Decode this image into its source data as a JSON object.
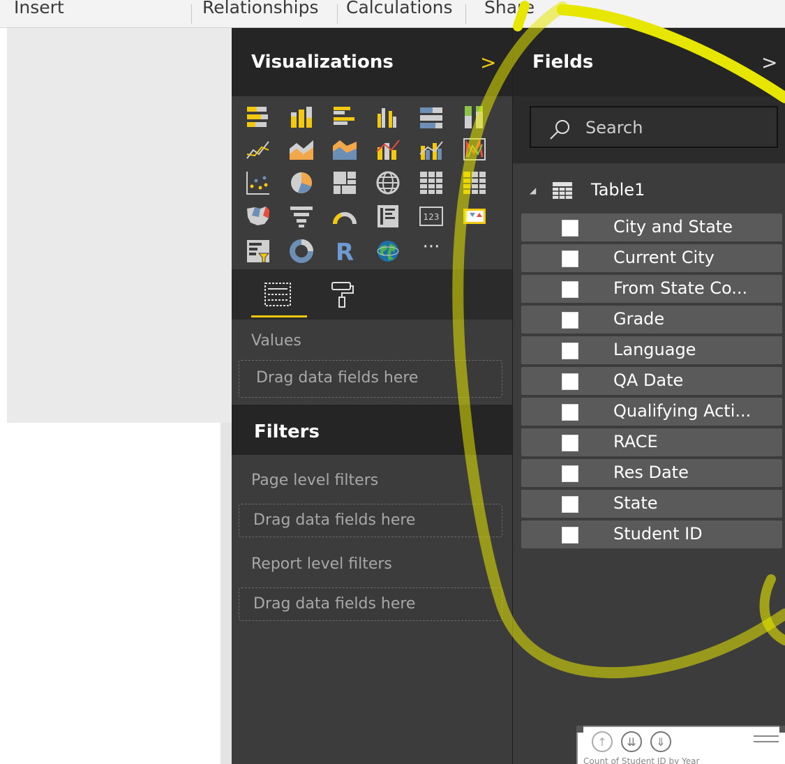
{
  "ribbon": {
    "tabs": [
      "Insert",
      "Relationships",
      "Calculations",
      "Share"
    ]
  },
  "visualizations": {
    "title": "Visualizations",
    "chevron": ">",
    "icons": [
      "stacked-bar-chart-icon",
      "stacked-column-chart-icon",
      "clustered-bar-chart-icon",
      "clustered-column-chart-icon",
      "100-stacked-bar-chart-icon",
      "100-stacked-column-chart-icon",
      "line-chart-icon",
      "area-chart-icon",
      "stacked-area-chart-icon",
      "line-and-stacked-column-icon",
      "line-and-clustered-column-icon",
      "ribbon-chart-icon",
      "scatter-chart-icon",
      "pie-chart-icon",
      "treemap-icon",
      "map-icon",
      "table-icon",
      "matrix-icon",
      "filled-map-icon",
      "funnel-icon",
      "gauge-icon",
      "multi-row-card-icon",
      "card-icon",
      "kpi-icon",
      "slicer-icon",
      "donut-chart-icon",
      "r-script-visual-icon",
      "arcgis-globe-icon",
      "more-visuals-icon"
    ],
    "more_glyph": "···",
    "r_glyph": "R",
    "card_glyph": "123",
    "values_label": "Values",
    "drop_text": "Drag data fields here"
  },
  "filters": {
    "title": "Filters",
    "page_level": "Page level filters",
    "report_level": "Report level filters",
    "drop_text_page": "Drag data fields here",
    "drop_text_report": "Drag data fields here"
  },
  "fields": {
    "title": "Fields",
    "chevron": ">",
    "search_placeholder": "Search",
    "table_name": "Table1",
    "items": [
      "City and State",
      "Current City",
      "From State Co...",
      "Grade",
      "Language",
      "QA Date",
      "Qualifying Acti...",
      "RACE",
      "Res Date",
      "State",
      "Student ID"
    ]
  },
  "mini_visual": {
    "caption": "Count of Student ID by Year"
  },
  "colors": {
    "accent": "#f2c811",
    "pane_dark": "#252525",
    "pane_body": "#3c3c3c",
    "field_row": "#5a5a5a",
    "annotation": "#e6e600"
  }
}
